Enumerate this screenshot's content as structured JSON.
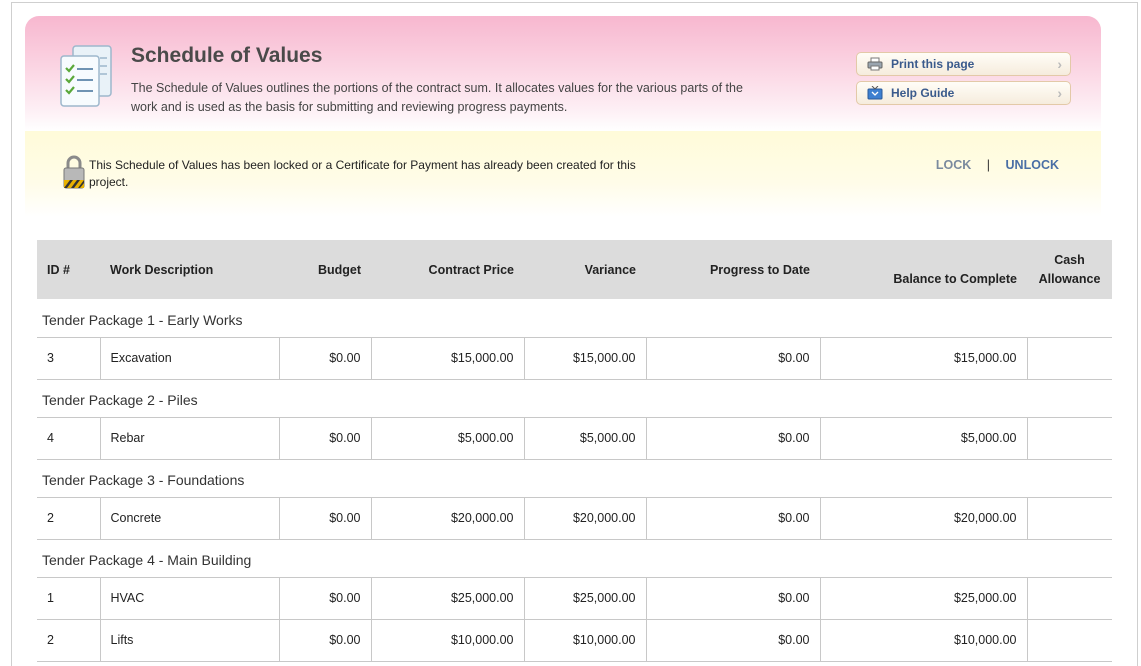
{
  "header": {
    "title": "Schedule of Values",
    "description": "The Schedule of Values outlines the portions of the contract sum. It allocates values for the various parts of the work and is used as the basis for submitting and reviewing progress payments.",
    "buttons": {
      "print": "Print this page",
      "help": "Help Guide"
    }
  },
  "notice": {
    "text": "This Schedule of Values has been locked or a Certificate for Payment has already been created for this project.",
    "lock": "LOCK",
    "separator": "|",
    "unlock": "UNLOCK"
  },
  "table": {
    "columns": {
      "id": "ID #",
      "description": "Work Description",
      "budget": "Budget",
      "contract_price": "Contract Price",
      "variance": "Variance",
      "progress": "Progress to Date",
      "balance": "Balance to Complete",
      "cash_allowance_1": "Cash",
      "cash_allowance_2": "Allowance"
    },
    "groups": [
      {
        "name": "Tender Package 1 - Early Works",
        "rows": [
          {
            "id": "3",
            "description": "Excavation",
            "budget": "$0.00",
            "contract_price": "$15,000.00",
            "variance": "$15,000.00",
            "progress": "$0.00",
            "balance": "$15,000.00",
            "cash": ""
          }
        ]
      },
      {
        "name": "Tender Package 2 - Piles",
        "rows": [
          {
            "id": "4",
            "description": "Rebar",
            "budget": "$0.00",
            "contract_price": "$5,000.00",
            "variance": "$5,000.00",
            "progress": "$0.00",
            "balance": "$5,000.00",
            "cash": ""
          }
        ]
      },
      {
        "name": "Tender Package 3 - Foundations",
        "rows": [
          {
            "id": "2",
            "description": "Concrete",
            "budget": "$0.00",
            "contract_price": "$20,000.00",
            "variance": "$20,000.00",
            "progress": "$0.00",
            "balance": "$20,000.00",
            "cash": ""
          }
        ]
      },
      {
        "name": "Tender Package 4 - Main Building",
        "rows": [
          {
            "id": "1",
            "description": "HVAC",
            "budget": "$0.00",
            "contract_price": "$25,000.00",
            "variance": "$25,000.00",
            "progress": "$0.00",
            "balance": "$25,000.00",
            "cash": ""
          },
          {
            "id": "2",
            "description": "Lifts",
            "budget": "$0.00",
            "contract_price": "$10,000.00",
            "variance": "$10,000.00",
            "progress": "$0.00",
            "balance": "$10,000.00",
            "cash": ""
          }
        ]
      }
    ]
  }
}
